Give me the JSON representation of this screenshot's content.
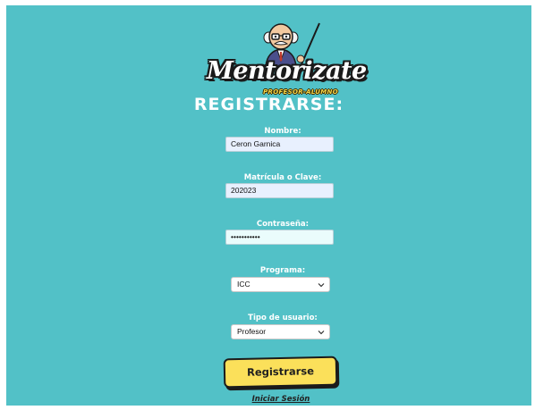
{
  "logo": {
    "wordmark": "Mentorizate",
    "tagline": "PROFESOR-ALUMNO"
  },
  "page_title": "REGISTRARSE:",
  "form": {
    "nombre": {
      "label": "Nombre:",
      "value": "Ceron Garnica"
    },
    "matricula": {
      "label": "Matrícula o Clave:",
      "value": "202023"
    },
    "password": {
      "label": "Contraseña:",
      "value": "•••••••••••"
    },
    "programa": {
      "label": "Programa:",
      "selected": "ICC"
    },
    "tipo_usuario": {
      "label": "Tipo de usuario:",
      "selected": "Profesor"
    }
  },
  "submit_label": "Registrarse",
  "login_link": "Iniciar Sesión",
  "colors": {
    "background": "#52c1c7",
    "button": "#fbe05a",
    "input_fill": "#e8f0fe"
  }
}
